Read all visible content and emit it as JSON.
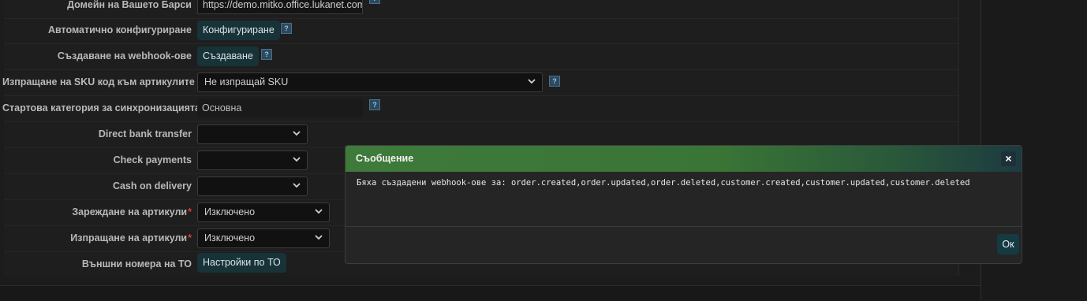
{
  "form": {
    "rows": [
      {
        "label": "Домейн на Вашето Барси",
        "value": "https://demo.mitko.office.lukanet.com"
      },
      {
        "label": "Автоматично конфигуриране",
        "button": "Конфигуриране"
      },
      {
        "label": "Създаване на webhook-ове",
        "button": "Създаване"
      },
      {
        "label": "Изпращане на SKU код към артикулите",
        "value": "Не изпращай SKU"
      },
      {
        "label": "Стартова категория за синхронизацията",
        "value": "Основна"
      },
      {
        "label": "Direct bank transfer",
        "value": ""
      },
      {
        "label": "Check payments",
        "value": ""
      },
      {
        "label": "Cash on delivery",
        "value": ""
      },
      {
        "label": "Зареждане на артикули",
        "required": "*",
        "value": "Изключено"
      },
      {
        "label": "Изпращане на артикули",
        "required": "*",
        "value": "Изключено"
      },
      {
        "label": "Външни номера на ТО",
        "button": "Настройки по ТО"
      }
    ],
    "help_glyph": "?"
  },
  "modal": {
    "title": "Съобщение",
    "close": "×",
    "message": "Бяха създадени webhook-ове за: order.created,order.updated,order.deleted,customer.created,customer.updated,customer.deleted",
    "ok": "Ок"
  },
  "colors": {
    "modal_header": "#3e7a3a",
    "button_bg": "#173338",
    "required": "#d04040"
  }
}
